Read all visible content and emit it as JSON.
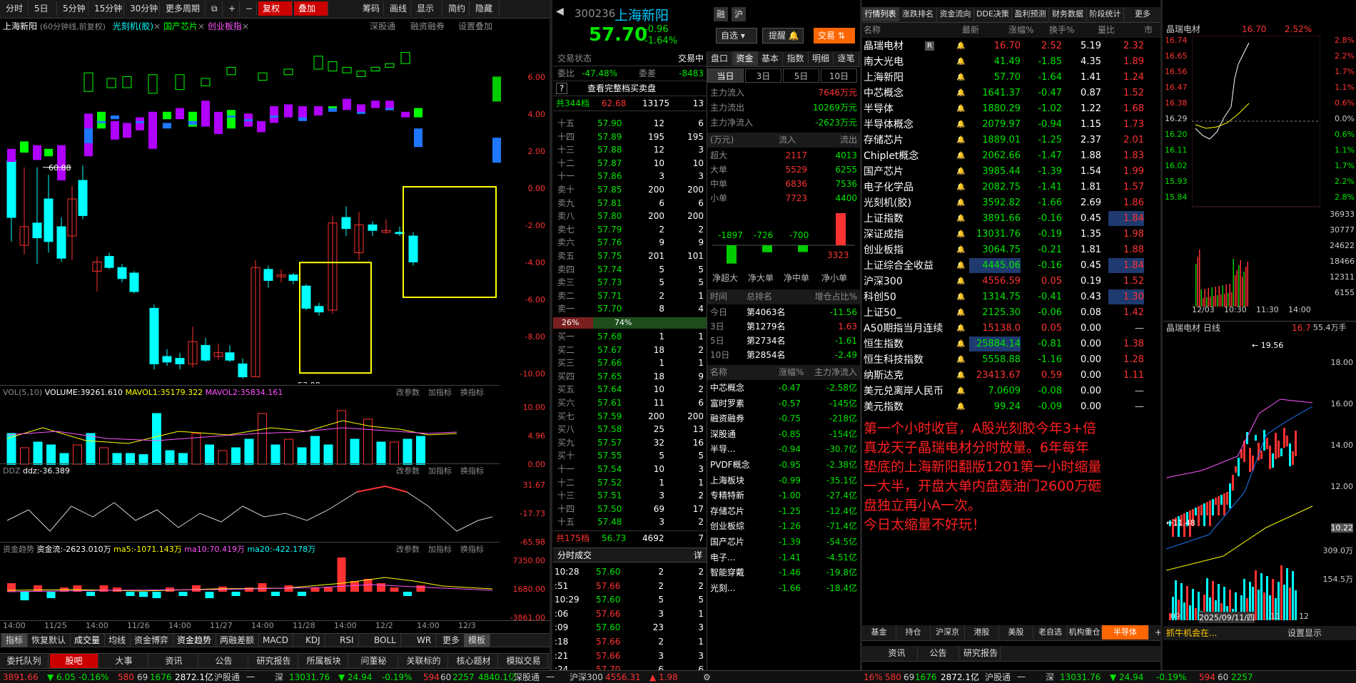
{
  "toolbar": {
    "items": [
      "分时",
      "5日",
      "5分钟",
      "15分钟",
      "30分钟",
      "更多周期",
      "复权",
      "叠加",
      "筹码",
      "画线",
      "显示",
      "简约",
      "隐藏"
    ]
  },
  "chart": {
    "title": "上海新阳",
    "subtitle": "(60分钟线,前复权)",
    "overlays": [
      "光刻机(胶)",
      "国产芯片",
      "创业板指"
    ],
    "links": [
      "深股通",
      "融资融券",
      "设置叠加"
    ],
    "y_labels": [
      "6.00",
      "4.00",
      "2.00",
      "0.00",
      "-2.00",
      "-4.00",
      "-6.00",
      "-8.00",
      "-10.00"
    ],
    "high_label": "60.88",
    "low_label": "53.98",
    "vol": {
      "label": "VOL(5,10)",
      "volume": "VOLUME:39261.610",
      "mavol1": "MAVOL1:35179.322",
      "mavol2": "MAVOL2:35834.161",
      "y": [
        "10.00",
        "4.96",
        "0.00"
      ]
    },
    "ddz": {
      "label": "DDZ",
      "val": "ddz:-36.389",
      "y": [
        "31.67",
        "-17.73",
        "-65.98"
      ]
    },
    "fund": {
      "label": "资金趋势",
      "val": "资金流:-2623.010万",
      "ma5": "ma5:-1071.143万",
      "ma10": "ma10:70.419万",
      "ma20": "ma20:-422.178万",
      "y": [
        "7350.00",
        "1680.00",
        "-3861.00"
      ]
    },
    "sub_actions": [
      "改参数",
      "加指标",
      "换指标"
    ],
    "x_labels": [
      "14:00",
      "11/25",
      "14:00",
      "11/26",
      "14:00",
      "11/27",
      "14:00",
      "11/28",
      "14:00",
      "12/2",
      "14:00",
      "12/3"
    ],
    "indicators": [
      "指标",
      "恢复默认",
      "成交量",
      "均线",
      "资金博弈",
      "资金趋势",
      "两融差额",
      "MACD",
      "KDJ",
      "RSI",
      "BOLL",
      "WR",
      "更多",
      "模板"
    ],
    "bottom_tabs": [
      "委托队列",
      "股吧",
      "大事",
      "资讯",
      "公告",
      "研究报告",
      "所属板块",
      "问董秘",
      "关联标的",
      "核心题材",
      "模拟交易"
    ]
  },
  "chart_data": [
    {
      "type": "candlestick",
      "x": [
        "11/25",
        "11/26",
        "11/27",
        "11/28",
        "12/2",
        "12/3"
      ],
      "ylabel": "涨跌幅%",
      "ylim": [
        -10,
        6
      ],
      "high": 60.88,
      "low": 53.98
    },
    {
      "type": "bar",
      "title": "VOL(5,10)",
      "ylim": [
        0,
        10
      ]
    },
    {
      "type": "line",
      "title": "DDZ",
      "ylim": [
        -65.98,
        31.67
      ]
    },
    {
      "type": "bar",
      "title": "资金趋势",
      "ylim": [
        -3861,
        7350
      ]
    }
  ],
  "quote": {
    "code": "300236",
    "name": "上海新阳",
    "btns": [
      "融",
      "沪"
    ],
    "price": "57.70",
    "chg": "-0.96",
    "pct": "-1.64%",
    "self": "自选",
    "remind": "提醒",
    "trade": "交易",
    "status_label": "交易状态",
    "status": "交易中",
    "wb_label": "委比",
    "wb": "-47.48%",
    "wc_label": "委差",
    "wc": "-8483",
    "see_all": "查看完整档买卖盘",
    "sell_total": {
      "label": "共344档",
      "price": "62.68",
      "vol": "13175",
      "n": "13"
    },
    "sells": [
      [
        "十五",
        "57.90",
        "12",
        "6"
      ],
      [
        "十四",
        "57.89",
        "195",
        "195"
      ],
      [
        "十三",
        "57.88",
        "12",
        "3"
      ],
      [
        "十二",
        "57.87",
        "10",
        "10"
      ],
      [
        "十一",
        "57.86",
        "3",
        "3"
      ],
      [
        "卖十",
        "57.85",
        "200",
        "200"
      ],
      [
        "卖九",
        "57.81",
        "6",
        "6"
      ],
      [
        "卖八",
        "57.80",
        "200",
        "200"
      ],
      [
        "卖七",
        "57.79",
        "2",
        "2"
      ],
      [
        "卖六",
        "57.76",
        "9",
        "9"
      ],
      [
        "卖五",
        "57.75",
        "201",
        "101"
      ],
      [
        "卖四",
        "57.74",
        "5",
        "5"
      ],
      [
        "卖三",
        "57.73",
        "5",
        "5"
      ],
      [
        "卖二",
        "57.71",
        "2",
        "1"
      ],
      [
        "卖一",
        "57.70",
        "8",
        "4"
      ]
    ],
    "ratio": [
      "26%",
      "74%"
    ],
    "buys": [
      [
        "买一",
        "57.68",
        "1",
        "1"
      ],
      [
        "买二",
        "57.67",
        "18",
        "2"
      ],
      [
        "买三",
        "57.66",
        "1",
        "1"
      ],
      [
        "买四",
        "57.65",
        "18",
        "9"
      ],
      [
        "买五",
        "57.64",
        "10",
        "2"
      ],
      [
        "买六",
        "57.61",
        "11",
        "6"
      ],
      [
        "买七",
        "57.59",
        "200",
        "200"
      ],
      [
        "买八",
        "57.58",
        "25",
        "13"
      ],
      [
        "买九",
        "57.57",
        "32",
        "16"
      ],
      [
        "买十",
        "57.55",
        "5",
        "5"
      ],
      [
        "十一",
        "57.54",
        "10",
        "3"
      ],
      [
        "十二",
        "57.52",
        "1",
        "1"
      ],
      [
        "十三",
        "57.51",
        "3",
        "2"
      ],
      [
        "十四",
        "57.50",
        "69",
        "17"
      ],
      [
        "十五",
        "57.48",
        "3",
        "2"
      ]
    ],
    "buy_total": {
      "label": "共175档",
      "price": "56.73",
      "vol": "4692",
      "n": "7"
    },
    "ticks_title": "分时成交",
    "ticks_more": "详",
    "ticks": [
      [
        "10:28",
        "57.60",
        "2",
        "2"
      ],
      [
        ":51",
        "57.66",
        "2",
        "2"
      ],
      [
        "10:29",
        "57.60",
        "5",
        "5"
      ],
      [
        ":06",
        "57.66",
        "3",
        "1"
      ],
      [
        ":09",
        "57.60",
        "23",
        "3"
      ],
      [
        ":18",
        "57.66",
        "2",
        "1"
      ],
      [
        ":21",
        "57.66",
        "3",
        "3"
      ],
      [
        ":24",
        "57.70",
        "6",
        "6"
      ]
    ]
  },
  "fund_panel": {
    "tabs": [
      "盘口",
      "资金",
      "基本",
      "指数",
      "明细",
      "逐笔"
    ],
    "days": [
      "当日",
      "3日",
      "5日",
      "10日"
    ],
    "main": [
      [
        "主力流入",
        "7646万元"
      ],
      [
        "主力流出",
        "10269万元"
      ],
      [
        "主力净流入",
        "-2623万元"
      ]
    ],
    "hdr": [
      "(万元)",
      "流入",
      "流出"
    ],
    "flows": [
      [
        "超大",
        "2117",
        "4013"
      ],
      [
        "大单",
        "5529",
        "6255"
      ],
      [
        "中单",
        "6836",
        "7536"
      ],
      [
        "小单",
        "7723",
        "4400"
      ]
    ],
    "net_vals": [
      "-1897",
      "-726",
      "-700",
      "3323"
    ],
    "net_labels": [
      "净超大",
      "净大单",
      "净中单",
      "净小单"
    ],
    "rank_hdr": [
      "时间",
      "总排名",
      "增仓占比%"
    ],
    "ranks": [
      [
        "今日",
        "第4063名",
        "-11.56"
      ],
      [
        "3日",
        "第1279名",
        "1.63"
      ],
      [
        "5日",
        "第2734名",
        "-1.61"
      ],
      [
        "10日",
        "第2854名",
        "-2.49"
      ]
    ],
    "sec_hdr": [
      "名称",
      "涨幅%",
      "主力净流入"
    ],
    "sectors": [
      [
        "中芯概念",
        "-0.47",
        "-2.58亿"
      ],
      [
        "富时罗素",
        "-0.57",
        "-145亿"
      ],
      [
        "融资融券",
        "-0.75",
        "-218亿"
      ],
      [
        "深股通",
        "-0.85",
        "-154亿"
      ],
      [
        "半导...",
        "-0.94",
        "-30.7亿"
      ],
      [
        "PVDF概念",
        "-0.95",
        "-2.38亿"
      ],
      [
        "上海板块",
        "-0.99",
        "-35.1亿"
      ],
      [
        "专精特新",
        "-1.00",
        "-27.4亿"
      ],
      [
        "存储芯片",
        "-1.25",
        "-12.4亿"
      ],
      [
        "创业板综",
        "-1.26",
        "-71.4亿"
      ],
      [
        "国产芯片",
        "-1.39",
        "-54.5亿"
      ],
      [
        "电子...",
        "-1.41",
        "-4.51亿"
      ],
      [
        "智能穿戴",
        "-1.46",
        "-19.8亿"
      ],
      [
        "光刻...",
        "-1.66",
        "-18.4亿"
      ]
    ]
  },
  "market": {
    "tabs": [
      "行情列表",
      "涨跌排名",
      "资金流向",
      "DDE决策",
      "盈利预测",
      "财务数据",
      "阶段统计",
      "更多"
    ],
    "hdr": [
      "名称",
      "",
      "最新",
      "涨幅%",
      "换手%",
      "量比",
      "市"
    ],
    "rows": [
      [
        "晶瑞电材",
        "R",
        "16.70",
        "2.52",
        "5.19",
        "2.32"
      ],
      [
        "南大光电",
        "",
        "41.49",
        "-1.85",
        "4.35",
        "1.89"
      ],
      [
        "上海新阳",
        "",
        "57.70",
        "-1.64",
        "1.41",
        "1.24"
      ],
      [
        "中芯概念",
        "",
        "1641.37",
        "-0.47",
        "0.87",
        "1.52"
      ],
      [
        "半导体",
        "",
        "1880.29",
        "-1.02",
        "1.22",
        "1.68"
      ],
      [
        "半导体概念",
        "",
        "2079.97",
        "-0.94",
        "1.15",
        "1.73"
      ],
      [
        "存储芯片",
        "",
        "1889.01",
        "-1.25",
        "2.37",
        "2.01"
      ],
      [
        "Chiplet概念",
        "",
        "2062.66",
        "-1.47",
        "1.88",
        "1.83"
      ],
      [
        "国产芯片",
        "",
        "3985.44",
        "-1.39",
        "1.54",
        "1.99"
      ],
      [
        "电子化学品",
        "",
        "2082.75",
        "-1.41",
        "1.81",
        "1.57"
      ],
      [
        "光刻机(胶)",
        "",
        "3592.82",
        "-1.66",
        "2.69",
        "1.86"
      ],
      [
        "上证指数",
        "",
        "3891.66",
        "-0.16",
        "0.45",
        "1.84"
      ],
      [
        "深证成指",
        "",
        "13031.76",
        "-0.19",
        "1.35",
        "1.98"
      ],
      [
        "创业板指",
        "",
        "3064.75",
        "-0.21",
        "1.81",
        "1.88"
      ],
      [
        "上证综合全收益",
        "",
        "4445.06",
        "-0.16",
        "0.45",
        "1.84"
      ],
      [
        "沪深300",
        "",
        "4556.59",
        "0.05",
        "0.19",
        "1.52"
      ],
      [
        "科创50",
        "",
        "1314.75",
        "-0.41",
        "0.43",
        "1.30"
      ],
      [
        "上证50_",
        "",
        "2125.30",
        "-0.06",
        "0.08",
        "1.42"
      ],
      [
        "A50期指当月连续",
        "",
        "15138.0",
        "0.05",
        "0.00",
        "—"
      ],
      [
        "恒生指数",
        "",
        "25884.14",
        "-0.81",
        "0.00",
        "1.38"
      ],
      [
        "恒生科技指数",
        "",
        "5558.88",
        "-1.16",
        "0.00",
        "1.28"
      ],
      [
        "纳斯达克",
        "",
        "23413.67",
        "0.59",
        "0.00",
        "1.11"
      ],
      [
        "美元兑离岸人民币",
        "",
        "7.0609",
        "-0.08",
        "0.00",
        "—"
      ],
      [
        "美元指数",
        "",
        "99.24",
        "-0.09",
        "0.00",
        "—"
      ]
    ],
    "note": [
      "第一个小时收官，A股光刻胶今年3+倍",
      "真龙天子晶瑞电材分时放量。6年每年",
      "垫底的上海新阳翻版1201第一小时缩量",
      "一大半，开盘大单内盘轰油门2600万砸",
      "盘独立再小A一次。",
      "今日太缩量不好玩！"
    ],
    "bottom_tabs": [
      "基金",
      "持仓",
      "沪深京",
      "港股",
      "美股",
      "老自选",
      "机构重仓",
      "半导体"
    ],
    "news_tabs": [
      "资讯",
      "公告",
      "研究报告"
    ],
    "ticker": "抓牛机会在...",
    "settings": "设置显示"
  },
  "mini": {
    "name": "晶瑞电材",
    "price": "16.70",
    "pct": "2.52%",
    "prices": [
      "16.74",
      "16.65",
      "16.56",
      "16.47",
      "16.38",
      "16.29",
      "16.20",
      "16.11",
      "16.02",
      "15.93",
      "15.84"
    ],
    "pcts": [
      "2.8%",
      "2.2%",
      "1.7%",
      "1.1%",
      "0.6%",
      "0.0%",
      "0.6%",
      "1.1%",
      "1.7%",
      "2.2%",
      "2.8%"
    ],
    "vols": [
      "36933",
      "30777",
      "24622",
      "18466",
      "12311",
      "6155"
    ],
    "times": [
      "12/03",
      "10:30",
      "11:30",
      "14:00"
    ],
    "daily_title": "晶瑞电材 日线",
    "daily_price": "16.7",
    "daily_vol": "55.4万手",
    "daily_high": "19.56",
    "daily_low": "11.48",
    "daily_y": [
      "18.00",
      "16.00",
      "14.00",
      "12.00",
      "10.22"
    ],
    "daily_vy": [
      "309.0万",
      "154.5万"
    ],
    "daily_x": [
      "09",
      "2025/09/11/四",
      "11",
      "12"
    ]
  },
  "status_bar": {
    "a": "3891.66",
    "b": "▼ 6.05",
    "c": "-0.16%",
    "d": "580",
    "e": "69",
    "f": "1676",
    "g": "2872.1亿",
    "h": "沪股通",
    "i": "一",
    "j": "深",
    "k": "13031.76",
    "l": "▼ 24.94",
    "m": "-0.19%",
    "n": "594",
    "o": "60",
    "p": "2257",
    "q": "4840.1亿",
    "r": "深股通",
    "s": "一",
    "t": "沪深300",
    "u": "4556.31",
    "v": "▲ 1.98",
    "w": "16%",
    "x": "580",
    "y": "69",
    "z": "1676",
    "aa": "2872.1亿",
    "ab": "沪股通",
    "ac": "一",
    "ad": "深",
    "ae": "13031.76",
    "af": "▼ 24.94",
    "ag": "-0.19%",
    "ah": "594",
    "ai": "60",
    "aj": "2257"
  },
  "colors": {
    "up": "#ff3232",
    "down": "#00e600",
    "cyan": "#00ffff",
    "purple": "#b000ff",
    "yellow": "#ffff00"
  }
}
